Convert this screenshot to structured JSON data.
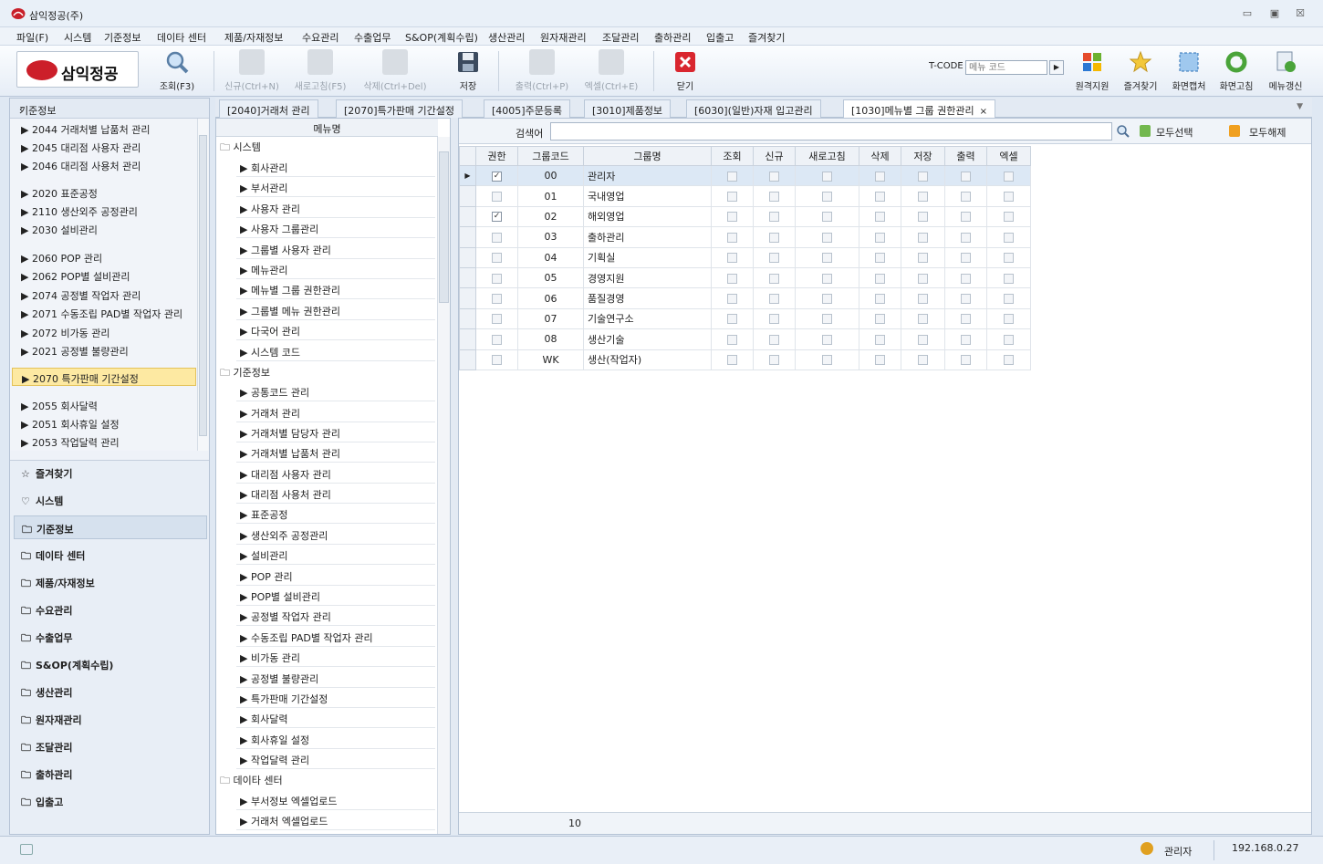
{
  "window": {
    "title": "삼익정공(주)",
    "minimize": "▭",
    "restore": "▣",
    "close": "☒"
  },
  "menu": [
    "파일(F)",
    "시스템",
    "기준정보",
    "데이타 센터",
    "제품/자재정보",
    "수요관리",
    "수출업무",
    "S&OP(계획수립)",
    "생산관리",
    "원자재관리",
    "조달관리",
    "출하관리",
    "입출고",
    "즐겨찾기"
  ],
  "toolbar": {
    "logo_text": "삼익정공",
    "search": "조회(F3)",
    "new": "신규(Ctrl+N)",
    "refresh": "새로고침(F5)",
    "delete": "삭제(Ctrl+Del)",
    "save": "저장",
    "print": "출력(Ctrl+P)",
    "excel": "엑셀(Ctrl+E)",
    "close": "닫기",
    "tcode_label": "T-CODE",
    "tcode_placeholder": "메뉴 코드",
    "remote": "원격지원",
    "favorites": "즐겨찾기",
    "capture": "화면캡처",
    "screen_refresh": "화면고침",
    "menu_update": "메뉴갱신"
  },
  "left_panel": {
    "title": "기준정보",
    "collapse": "‹",
    "items": [
      "▶ 2044 거래처별 납품처 관리",
      "▶ 2045 대리점 사용자 관리",
      "▶ 2046 대리점 사용처 관리",
      "▶ 2020 표준공정",
      "▶ 2110 생산외주 공정관리",
      "▶ 2030 설비관리",
      "▶ 2060 POP 관리",
      "▶ 2062 POP별 설비관리",
      "▶ 2074 공정별 작업자 관리",
      "▶ 2071 수동조립 PAD별 작업자 관리",
      "▶ 2072 비가동 관리",
      "▶ 2021 공정별 불량관리",
      "▶ 2070 특가판매 기간설정",
      "▶ 2055 회사달력",
      "▶ 2051 회사휴일 설정",
      "▶ 2053 작업달력 관리"
    ],
    "nav": [
      {
        "icon": "☆",
        "label": "즐겨찾기"
      },
      {
        "icon": "♡",
        "label": "시스템"
      },
      {
        "icon": "🗀",
        "label": "기준정보"
      },
      {
        "icon": "🗀",
        "label": "데이타 센터"
      },
      {
        "icon": "🗀",
        "label": "제품/자재정보"
      },
      {
        "icon": "🗀",
        "label": "수요관리"
      },
      {
        "icon": "🗀",
        "label": "수출업무"
      },
      {
        "icon": "🗀",
        "label": "S&OP(계획수립)"
      },
      {
        "icon": "🗀",
        "label": "생산관리"
      },
      {
        "icon": "🗀",
        "label": "원자재관리"
      },
      {
        "icon": "🗀",
        "label": "조달관리"
      },
      {
        "icon": "🗀",
        "label": "출하관리"
      },
      {
        "icon": "🗀",
        "label": "입출고"
      }
    ]
  },
  "tabs": [
    "[2040]거래처 관리",
    "[2070]특가판매 기간설정",
    "[4005]주문등록",
    "[3010]제품정보",
    "[6030](일반)자재 입고관리",
    "[1030]메뉴별 그룹 권한관리"
  ],
  "tab_close": "×",
  "tab_menu": "▼",
  "tree": {
    "header": "메뉴명",
    "groups": [
      {
        "label": "🗀 시스템",
        "items": [
          "▶ 회사관리",
          "▶ 부서관리",
          "▶ 사용자 관리",
          "▶ 사용자 그룹관리",
          "▶ 그룹별 사용자 관리",
          "▶ 메뉴관리",
          "▶ 메뉴별 그룹 권한관리",
          "▶ 그룹별 메뉴 권한관리",
          "▶ 다국어 관리",
          "▶ 시스템 코드"
        ]
      },
      {
        "label": "🗀 기준정보",
        "items": [
          "▶ 공통코드 관리",
          "▶ 거래처 관리",
          "▶ 거래처별 담당자 관리",
          "▶ 거래처별 납품처 관리",
          "▶ 대리점 사용자 관리",
          "▶ 대리점 사용처 관리",
          "▶ 표준공정",
          "▶ 생산외주 공정관리",
          "▶ 설비관리",
          "▶ POP 관리",
          "▶ POP별 설비관리",
          "▶ 공정별 작업자 관리",
          "▶ 수동조립 PAD별 작업자 관리",
          "▶ 비가동 관리",
          "▶ 공정별 불량관리",
          "▶ 특가판매 기간설정",
          "▶ 회사달력",
          "▶ 회사휴일 설정",
          "▶ 작업달력 관리"
        ]
      },
      {
        "label": "🗀 데이타 센터",
        "items": [
          "▶ 부서정보 엑셀업로드",
          "▶ 거래처 엑셀업로드"
        ]
      }
    ]
  },
  "grid_panel": {
    "search_label": "검색어",
    "search_value": "",
    "select_all": "모두선택",
    "clear_all": "모두해제",
    "columns": [
      "권한",
      "그룹코드",
      "그룹명",
      "조회",
      "신규",
      "새로고침",
      "삭제",
      "저장",
      "출력",
      "엑셀"
    ],
    "rows": [
      {
        "auth": true,
        "code": "00",
        "name": "관리자"
      },
      {
        "auth": false,
        "code": "01",
        "name": "국내영업"
      },
      {
        "auth": true,
        "code": "02",
        "name": "해외영업"
      },
      {
        "auth": false,
        "code": "03",
        "name": "출하관리"
      },
      {
        "auth": false,
        "code": "04",
        "name": "기획실"
      },
      {
        "auth": false,
        "code": "05",
        "name": "경영지원"
      },
      {
        "auth": false,
        "code": "06",
        "name": "품질경영"
      },
      {
        "auth": false,
        "code": "07",
        "name": "기술연구소"
      },
      {
        "auth": false,
        "code": "08",
        "name": "생산기술"
      },
      {
        "auth": false,
        "code": "WK",
        "name": "생산(작업자)"
      }
    ],
    "row_count": "10"
  },
  "status": {
    "user": "관리자",
    "ip": "192.168.0.27"
  }
}
